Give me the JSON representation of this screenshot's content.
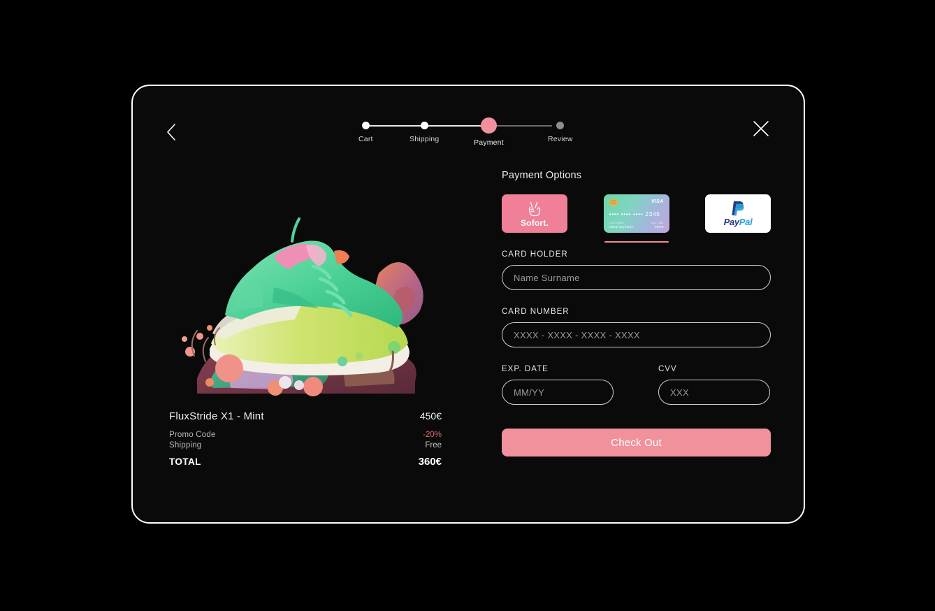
{
  "header": {
    "back_icon": "chevron-left-icon",
    "close_icon": "close-icon"
  },
  "stepper": {
    "steps": [
      {
        "label": "Cart",
        "state": "done"
      },
      {
        "label": "Shipping",
        "state": "done"
      },
      {
        "label": "Payment",
        "state": "active"
      },
      {
        "label": "Review",
        "state": "pending"
      }
    ],
    "active_color": "#f2909e",
    "done_color": "#ffffff",
    "pending_color": "#8d8d8d"
  },
  "product": {
    "image_alt": "mint green sneaker on colorful abstract base",
    "name": "FluxStride X1 - Mint",
    "price": "450€"
  },
  "summary": {
    "rows": [
      {
        "label": "Promo Code",
        "value": "-20%",
        "accent": "#e06b72"
      },
      {
        "label": "Shipping",
        "value": "Free",
        "accent": ""
      }
    ],
    "total_label": "TOTAL",
    "total_value": "360€"
  },
  "payment": {
    "section_title": "Payment Options",
    "options": [
      {
        "id": "sofort",
        "name": "Sofort.",
        "selected": false
      },
      {
        "id": "visa",
        "name": "VISA",
        "selected": true
      },
      {
        "id": "paypal",
        "name": "PayPal",
        "selected": false
      }
    ],
    "sofort_label": "Sofort.",
    "visa_mark": "VISA",
    "visa_number": "•••• •••• •••• 2345",
    "visa_holder_caption": "Card Holder",
    "visa_holder_value": "Name Surname",
    "visa_exp_caption": "Exp. Date",
    "visa_exp_value": "00/00",
    "paypal_word_a": "Pay",
    "paypal_word_b": "Pal",
    "selected_indicator_color": "#ee8d95"
  },
  "form": {
    "card_holder_label": "CARD HOLDER",
    "card_holder_placeholder": "Name Surname",
    "card_holder_value": "",
    "card_number_label": "CARD NUMBER",
    "card_number_placeholder": "XXXX - XXXX - XXXX - XXXX",
    "card_number_value": "",
    "exp_label": "EXP. DATE",
    "exp_placeholder": "MM/YY",
    "exp_value": "",
    "cvv_label": "CVV",
    "cvv_placeholder": "XXX",
    "cvv_value": "",
    "checkout_label": "Check Out",
    "checkout_color": "#f0919c"
  }
}
